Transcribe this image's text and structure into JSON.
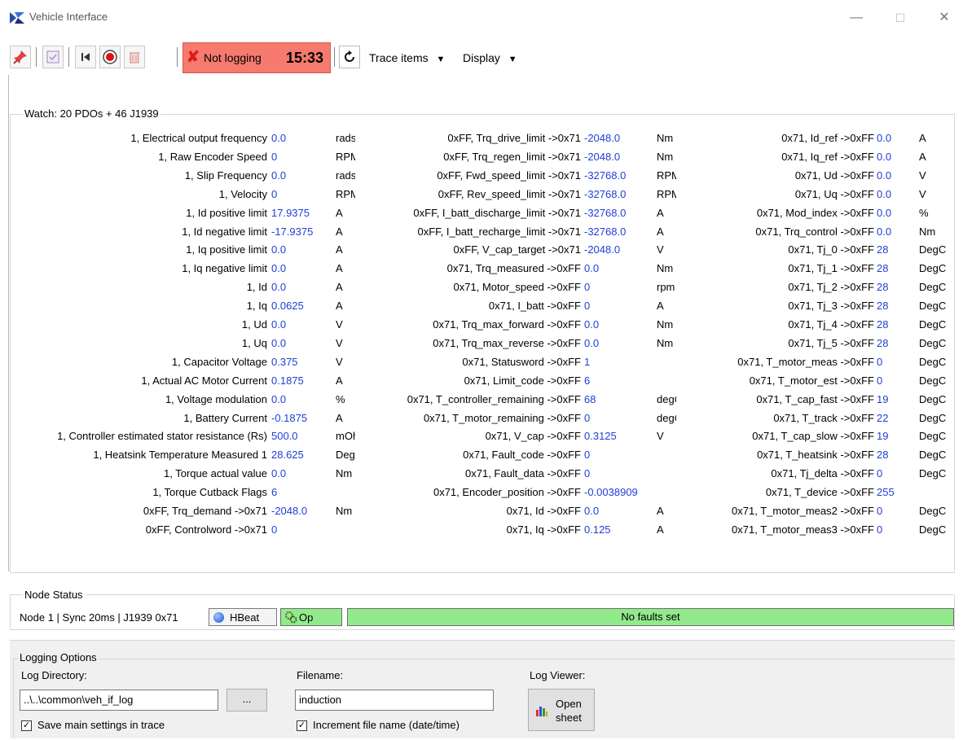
{
  "window": {
    "title": "Vehicle Interface",
    "minimize": "—",
    "maximize": "☐",
    "close": "✕"
  },
  "toolbar": {
    "status_text": "Not logging",
    "status_time": "15:33",
    "trace_items": "Trace items",
    "display": "Display",
    "dropdown_arrow": "▼",
    "icons": [
      "pin-icon",
      "checklist-icon",
      "step-back-icon",
      "record-icon",
      "clear-icon",
      "refresh-icon"
    ],
    "status_color": "#f67a6e"
  },
  "watch": {
    "title": "Watch:  20 PDOs + 46 J1939",
    "col1": [
      {
        "label": "1, Electrical output frequency",
        "value": "0.0",
        "unit": "rads/s"
      },
      {
        "label": "1, Raw Encoder Speed",
        "value": "0",
        "unit": "RPM"
      },
      {
        "label": "1, Slip Frequency",
        "value": "0.0",
        "unit": "rads/s"
      },
      {
        "label": "1, Velocity",
        "value": "0",
        "unit": "RPM"
      },
      {
        "label": "1, Id positive limit",
        "value": "17.9375",
        "unit": "A"
      },
      {
        "label": "1, Id negative limit",
        "value": "-17.9375",
        "unit": "A"
      },
      {
        "label": "1, Iq positive limit",
        "value": "0.0",
        "unit": "A"
      },
      {
        "label": "1, Iq negative limit",
        "value": "0.0",
        "unit": "A"
      },
      {
        "label": "1, Id",
        "value": "0.0",
        "unit": "A"
      },
      {
        "label": "1, Iq",
        "value": "0.0625",
        "unit": "A"
      },
      {
        "label": "1, Ud",
        "value": "0.0",
        "unit": "V"
      },
      {
        "label": "1, Uq",
        "value": "0.0",
        "unit": "V"
      },
      {
        "label": "1, Capacitor Voltage",
        "value": "0.375",
        "unit": "V"
      },
      {
        "label": "1, Actual AC Motor Current",
        "value": "0.1875",
        "unit": "A"
      },
      {
        "label": "1, Voltage modulation",
        "value": "0.0",
        "unit": "%"
      },
      {
        "label": "1, Battery Current",
        "value": "-0.1875",
        "unit": "A"
      },
      {
        "label": "1, Controller estimated stator resistance (Rs)",
        "value": "500.0",
        "unit": "mOhm"
      },
      {
        "label": "1, Heatsink Temperature Measured 1",
        "value": "28.625",
        "unit": "DegC"
      },
      {
        "label": "1, Torque actual value",
        "value": "0.0",
        "unit": "Nm"
      },
      {
        "label": "1, Torque Cutback Flags",
        "value": "6",
        "unit": ""
      },
      {
        "label": "0xFF, Trq_demand ->0x71",
        "value": "-2048.0",
        "unit": "Nm"
      },
      {
        "label": "0xFF, Controlword ->0x71",
        "value": "0",
        "unit": ""
      }
    ],
    "col2": [
      {
        "label": "0xFF, Trq_drive_limit ->0x71",
        "value": "-2048.0",
        "unit": "Nm"
      },
      {
        "label": "0xFF, Trq_regen_limit ->0x71",
        "value": "-2048.0",
        "unit": "Nm"
      },
      {
        "label": "0xFF, Fwd_speed_limit ->0x71",
        "value": "-32768.0",
        "unit": "RPM"
      },
      {
        "label": "0xFF, Rev_speed_limit ->0x71",
        "value": "-32768.0",
        "unit": "RPM"
      },
      {
        "label": "0xFF, I_batt_discharge_limit ->0x71",
        "value": "-32768.0",
        "unit": "A"
      },
      {
        "label": "0xFF, I_batt_recharge_limit ->0x71",
        "value": "-32768.0",
        "unit": "A"
      },
      {
        "label": "0xFF, V_cap_target ->0x71",
        "value": "-2048.0",
        "unit": "V"
      },
      {
        "label": "0x71, Trq_measured ->0xFF",
        "value": "0.0",
        "unit": "Nm"
      },
      {
        "label": "0x71, Motor_speed ->0xFF",
        "value": "0",
        "unit": "rpm"
      },
      {
        "label": "0x71, I_batt ->0xFF",
        "value": "0",
        "unit": "A"
      },
      {
        "label": "0x71, Trq_max_forward ->0xFF",
        "value": "0.0",
        "unit": "Nm"
      },
      {
        "label": "0x71, Trq_max_reverse ->0xFF",
        "value": "0.0",
        "unit": "Nm"
      },
      {
        "label": "0x71, Statusword ->0xFF",
        "value": "1",
        "unit": ""
      },
      {
        "label": "0x71, Limit_code ->0xFF",
        "value": "6",
        "unit": ""
      },
      {
        "label": "0x71, T_controller_remaining ->0xFF",
        "value": "68",
        "unit": "degC"
      },
      {
        "label": "0x71, T_motor_remaining ->0xFF",
        "value": "0",
        "unit": "degC"
      },
      {
        "label": "0x71, V_cap ->0xFF",
        "value": "0.3125",
        "unit": "V"
      },
      {
        "label": "0x71, Fault_code ->0xFF",
        "value": "0",
        "unit": ""
      },
      {
        "label": "0x71, Fault_data ->0xFF",
        "value": "0",
        "unit": ""
      },
      {
        "label": "0x71, Encoder_position ->0xFF",
        "value": "-0.0038909",
        "unit": ""
      },
      {
        "label": "0x71, Id ->0xFF",
        "value": "0.0",
        "unit": "A"
      },
      {
        "label": "0x71, Iq ->0xFF",
        "value": "0.125",
        "unit": "A"
      }
    ],
    "col3": [
      {
        "label": "0x71, Id_ref ->0xFF",
        "value": "0.0",
        "unit": "A"
      },
      {
        "label": "0x71, Iq_ref ->0xFF",
        "value": "0.0",
        "unit": "A"
      },
      {
        "label": "0x71, Ud ->0xFF",
        "value": "0.0",
        "unit": "V"
      },
      {
        "label": "0x71, Uq ->0xFF",
        "value": "0.0",
        "unit": "V"
      },
      {
        "label": "0x71, Mod_index ->0xFF",
        "value": "0.0",
        "unit": "%"
      },
      {
        "label": "0x71, Trq_control ->0xFF",
        "value": "0.0",
        "unit": "Nm"
      },
      {
        "label": "0x71, Tj_0 ->0xFF",
        "value": "28",
        "unit": "DegC"
      },
      {
        "label": "0x71, Tj_1 ->0xFF",
        "value": "28",
        "unit": "DegC"
      },
      {
        "label": "0x71, Tj_2 ->0xFF",
        "value": "28",
        "unit": "DegC"
      },
      {
        "label": "0x71, Tj_3 ->0xFF",
        "value": "28",
        "unit": "DegC"
      },
      {
        "label": "0x71, Tj_4 ->0xFF",
        "value": "28",
        "unit": "DegC"
      },
      {
        "label": "0x71, Tj_5 ->0xFF",
        "value": "28",
        "unit": "DegC"
      },
      {
        "label": "0x71, T_motor_meas ->0xFF",
        "value": "0",
        "unit": "DegC"
      },
      {
        "label": "0x71, T_motor_est ->0xFF",
        "value": "0",
        "unit": "DegC"
      },
      {
        "label": "0x71, T_cap_fast ->0xFF",
        "value": "19",
        "unit": "DegC"
      },
      {
        "label": "0x71, T_track ->0xFF",
        "value": "22",
        "unit": "DegC"
      },
      {
        "label": "0x71, T_cap_slow ->0xFF",
        "value": "19",
        "unit": "DegC"
      },
      {
        "label": "0x71, T_heatsink ->0xFF",
        "value": "28",
        "unit": "DegC"
      },
      {
        "label": "0x71, Tj_delta ->0xFF",
        "value": "0",
        "unit": "DegC"
      },
      {
        "label": "0x71, T_device ->0xFF",
        "value": "255",
        "unit": ""
      },
      {
        "label": "0x71, T_motor_meas2 ->0xFF",
        "value": "0",
        "unit": "DegC"
      },
      {
        "label": "0x71, T_motor_meas3 ->0xFF",
        "value": "0",
        "unit": "DegC"
      }
    ],
    "value_color": "#1f3fd6"
  },
  "node_status": {
    "title": "Node Status",
    "info": "Node 1 | Sync 20ms | J1939 0x71",
    "hbeat": "HBeat",
    "op": "Op",
    "faults": "No faults set",
    "ok_color": "#92ea8d"
  },
  "logging": {
    "title": "Logging Options",
    "dir_label": "Log Directory:",
    "dir_value": "..\\..\\common\\veh_if_log",
    "browse": "...",
    "filename_label": "Filename:",
    "filename_value": "induction",
    "viewer_label": "Log Viewer:",
    "open_sheet_line1": "Open",
    "open_sheet_line2": "sheet",
    "save_settings": "Save main settings in trace",
    "increment": "Increment file name (date/time)",
    "check_mark": "✓"
  }
}
